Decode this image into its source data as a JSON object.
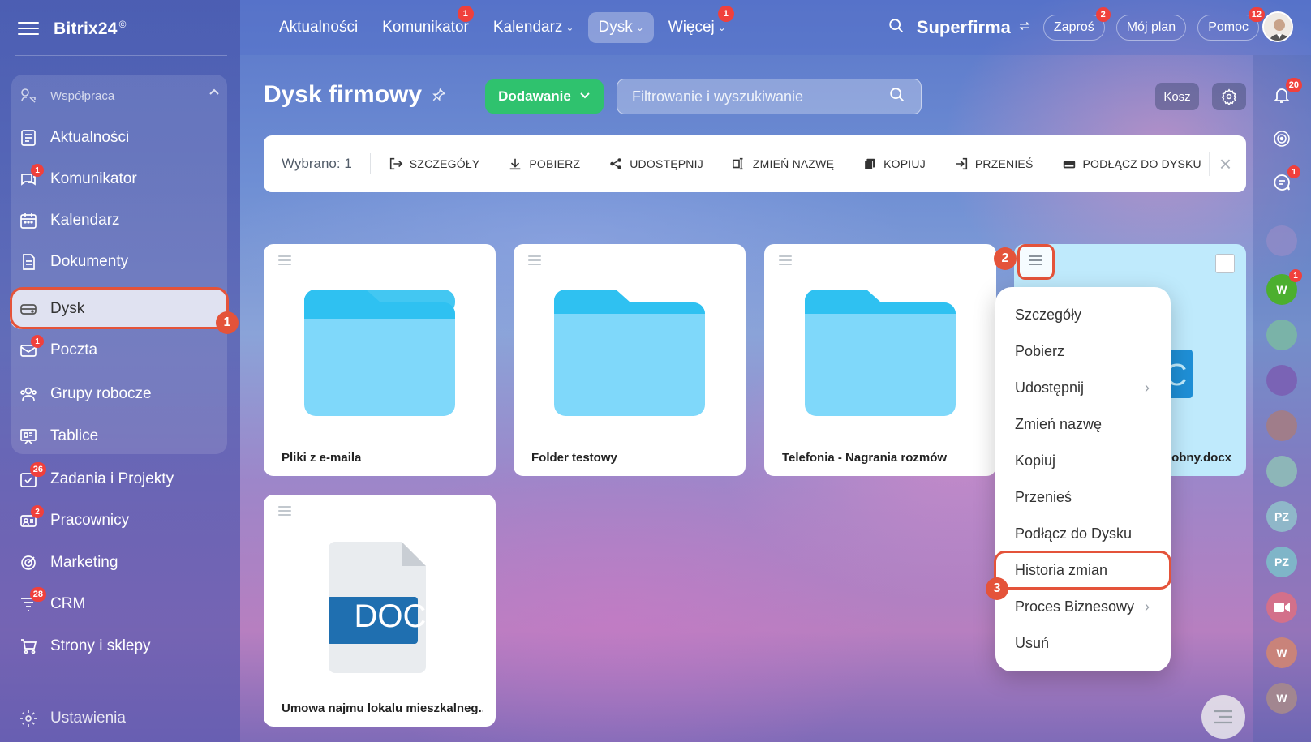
{
  "app": {
    "logo": "Bitrix24",
    "logo_mark": "©"
  },
  "sidebar": {
    "section_label": "Współpraca",
    "items": [
      {
        "label": "Aktualności",
        "badge": ""
      },
      {
        "label": "Komunikator",
        "badge": "1"
      },
      {
        "label": "Kalendarz",
        "badge": ""
      },
      {
        "label": "Dokumenty",
        "badge": ""
      },
      {
        "label": "Dysk",
        "badge": ""
      },
      {
        "label": "Poczta",
        "badge": "1"
      },
      {
        "label": "Grupy robocze",
        "badge": ""
      },
      {
        "label": "Tablice",
        "badge": ""
      },
      {
        "label": "Zadania i Projekty",
        "badge": "26"
      },
      {
        "label": "Pracownicy",
        "badge": "2"
      },
      {
        "label": "Marketing",
        "badge": ""
      },
      {
        "label": "CRM",
        "badge": "28"
      },
      {
        "label": "Strony i sklepy",
        "badge": ""
      },
      {
        "label": "Ustawienia",
        "badge": ""
      }
    ]
  },
  "topnav": {
    "items": [
      {
        "label": "Aktualności",
        "badge": ""
      },
      {
        "label": "Komunikator",
        "badge": "1"
      },
      {
        "label": "Kalendarz",
        "badge": ""
      },
      {
        "label": "Dysk",
        "badge": ""
      },
      {
        "label": "Więcej",
        "badge": "1"
      }
    ],
    "company": "Superfirma",
    "invite": {
      "label": "Zaproś",
      "badge": "2"
    },
    "plan": "Mój plan",
    "help": {
      "label": "Pomoc",
      "badge": "12"
    }
  },
  "page": {
    "title": "Dysk firmowy",
    "add_button": "Dodawanie",
    "search_placeholder": "Filtrowanie i wyszukiwanie",
    "trash": "Kosz",
    "notifications_badge": "20"
  },
  "action_bar": {
    "selected": "Wybrano: 1",
    "actions": [
      "SZCZEGÓŁY",
      "POBIERZ",
      "UDOSTĘPNIJ",
      "ZMIEŃ NAZWĘ",
      "KOPIUJ",
      "PRZENIEŚ",
      "PODŁĄCZ DO DYSKU"
    ]
  },
  "files": [
    {
      "name": "Pliki z e-maila",
      "type": "folder"
    },
    {
      "name": "Folder testowy",
      "type": "folder"
    },
    {
      "name": "Telefonia - Nagrania rozmów",
      "type": "folder"
    },
    {
      "name": "robny.docx",
      "type": "docx"
    },
    {
      "name": "Umowa najmu lokalu mieszkalneg...",
      "type": "doc",
      "icon_label": "DOC"
    }
  ],
  "context_menu": {
    "items": [
      {
        "label": "Szczegóły",
        "submenu": false
      },
      {
        "label": "Pobierz",
        "submenu": false
      },
      {
        "label": "Udostępnij",
        "submenu": true
      },
      {
        "label": "Zmień nazwę",
        "submenu": false
      },
      {
        "label": "Kopiuj",
        "submenu": false
      },
      {
        "label": "Przenieś",
        "submenu": false
      },
      {
        "label": "Podłącz do Dysku",
        "submenu": false
      },
      {
        "label": "Historia zmian",
        "submenu": false
      },
      {
        "label": "Proces Biznesowy",
        "submenu": true
      },
      {
        "label": "Usuń",
        "submenu": false
      }
    ]
  },
  "steps": [
    "1",
    "2",
    "3"
  ],
  "right_strip": {
    "chat_badge": "1",
    "avatars": [
      {
        "initials": "W",
        "color": "#4caf2f",
        "badge": "1"
      },
      {
        "initials": "PZ",
        "color": "#8fb7c9",
        "badge": ""
      },
      {
        "initials": "PZ",
        "color": "#7fb5c8",
        "badge": ""
      },
      {
        "initials": "W",
        "color": "#c9837a",
        "badge": ""
      },
      {
        "initials": "W",
        "color": "#a28690",
        "badge": ""
      }
    ]
  },
  "colors": {
    "accent_green": "#2fc26e",
    "highlight": "#e4533a",
    "badge_red": "#f0403c",
    "folder_blue": "#7fd8fa",
    "doc_blue": "#1f6fb0"
  }
}
